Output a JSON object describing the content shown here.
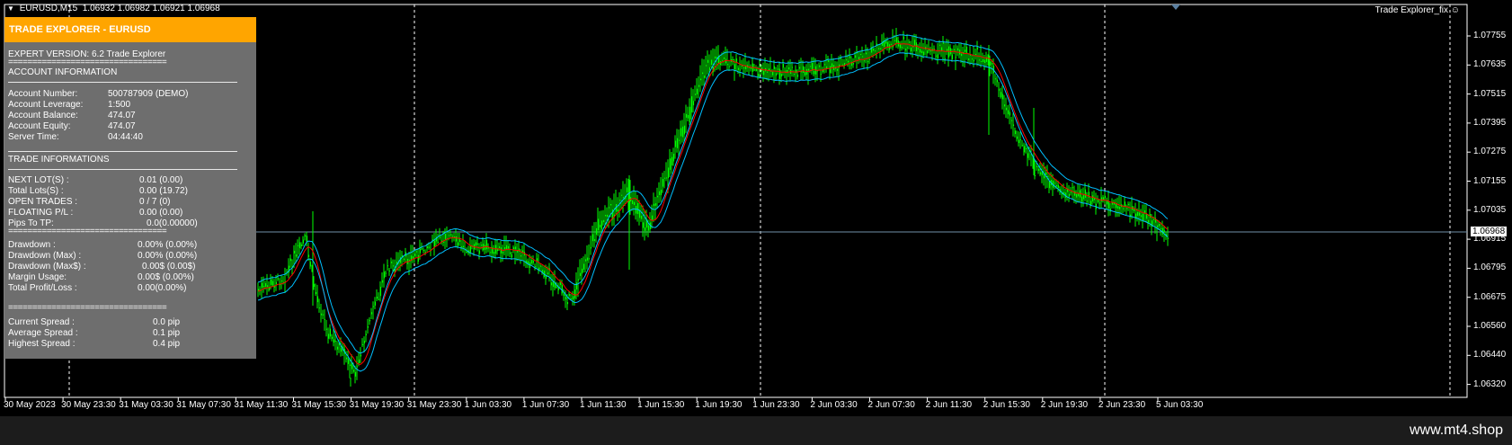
{
  "header": {
    "symbol": "EURUSD,M15",
    "quotes": "1.06932 1.06982 1.06921 1.06968",
    "indicator_label": "Trade Explorer_fix"
  },
  "panel": {
    "title": "TRADE EXPLORER - EURUSD",
    "expert_version": "EXPERT VERSION: 6.2 Trade Explorer",
    "sep_line": "=================================",
    "account_header": "ACCOUNT INFORMATION",
    "account": [
      {
        "label": "Account Number:",
        "value": "500787909 (DEMO)"
      },
      {
        "label": "Account Leverage:",
        "value": "1:500"
      },
      {
        "label": "Account Balance:",
        "value": "474.07"
      },
      {
        "label": "Account Equity:",
        "value": "474.07"
      },
      {
        "label": "Server Time:",
        "value": "04:44:40"
      }
    ],
    "trade_header": "TRADE INFORMATIONS",
    "trade": [
      {
        "label": "NEXT LOT(S) :",
        "value": "0.01 (0.00)"
      },
      {
        "label": "Total Lots(S) :",
        "value": "0.00 (19.72)"
      },
      {
        "label": "OPEN TRADES :",
        "value": "0 / 7 (0)"
      },
      {
        "label": "FLOATING P/L :",
        "value": "0.00 (0.00)"
      },
      {
        "label": "Pips To TP:",
        "value": "0.0(0.00000)"
      }
    ],
    "drawdown": [
      {
        "label": "Drawdown :",
        "value": "0.00% (0.00%)"
      },
      {
        "label": "Drawdown (Max) :",
        "value": "0.00% (0.00%)"
      },
      {
        "label": "Drawdown (Max$) :",
        "value": "0.00$ (0.00$)"
      },
      {
        "label": "Margin Usage:",
        "value": "0.00$ (0.00%)"
      },
      {
        "label": "Total Profit/Loss :",
        "value": "0.00(0.00%)"
      }
    ],
    "spread": [
      {
        "label": "Current Spread :",
        "value": "0.0 pip"
      },
      {
        "label": "Average Spread :",
        "value": "0.1 pip"
      },
      {
        "label": "Highest Spread :",
        "value": "0.4 pip"
      }
    ]
  },
  "price_axis": [
    "1.07755",
    "1.07635",
    "1.07515",
    "1.07395",
    "1.07275",
    "1.07155",
    "1.07035",
    "1.06915",
    "1.06795",
    "1.06675",
    "1.06560",
    "1.06440",
    "1.06320"
  ],
  "current_price": "1.06968",
  "time_axis": [
    "30 May 2023",
    "30 May 23:30",
    "31 May 03:30",
    "31 May 07:30",
    "31 May 11:30",
    "31 May 15:30",
    "31 May 19:30",
    "31 May 23:30",
    "1 Jun 03:30",
    "1 Jun 07:30",
    "1 Jun 11:30",
    "1 Jun 15:30",
    "1 Jun 19:30",
    "1 Jun 23:30",
    "2 Jun 03:30",
    "2 Jun 07:30",
    "2 Jun 11:30",
    "2 Jun 15:30",
    "2 Jun 19:30",
    "2 Jun 23:30",
    "5 Jun 03:30"
  ],
  "colors": {
    "bull_candle": "#00ff00",
    "bear_candle": "#00ff00",
    "ma_line": "#ff0000",
    "band": "#00bfff",
    "panel_bg": "#6e6e6e",
    "panel_header": "#ffa500"
  },
  "footer": {
    "brand": "www.mt4.shop"
  }
}
